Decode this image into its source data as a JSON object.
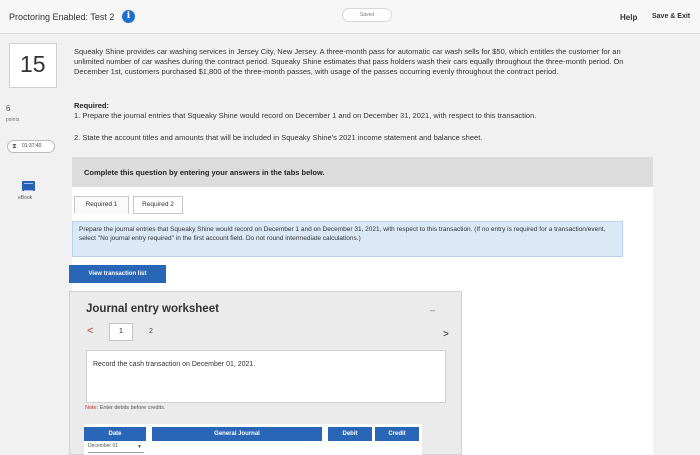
{
  "header": {
    "title": "Proctoring Enabled: Test 2",
    "saved_label": "Saved",
    "help_label": "Help",
    "save_exit_label": "Save & Exit"
  },
  "sidebar": {
    "question_number": "15",
    "points_value": "6",
    "points_label": "points",
    "timer": "01:37:40",
    "ebook_label": "eBook"
  },
  "question": {
    "text": "Squeaky Shine provides car washing services in Jersey City, New Jersey. A three-month pass for automatic car wash sells for $50, which entitles the customer for an unlimited number of car washes during the contract period. Squeaky Shine estimates that pass holders wash their cars equally throughout the three-month period. On December 1st, customers purchased $1,800 of the three-month passes, with usage of the passes occurring evenly throughout the contract period.",
    "required_title": "Required:",
    "required_1": "1. Prepare the journal entries that Squeaky Shine would record on December 1 and on December 31, 2021, with respect to this transaction.",
    "required_2": "2. State the account titles and amounts that will be included in Squeaky Shine's 2021 income statement and balance sheet."
  },
  "instruction": "Complete this question by entering your answers in the tabs below.",
  "tabs": [
    {
      "label": "Required 1"
    },
    {
      "label": "Required 2"
    }
  ],
  "prompt": "Prepare the journal entries that Squeaky Shine would record on December 1 and on December 31, 2021, with respect to this transaction. (If no entry is required for a transaction/event, select \"No journal entry required\" in the first account field. Do not round intermediate calculations.)",
  "view_transaction_label": "View transaction list",
  "worksheet": {
    "title": "Journal entry worksheet",
    "pages": [
      "1",
      "2"
    ],
    "record_text": "Record the cash transaction on December 01, 2021.",
    "note_label": "Note:",
    "note_text": "Enter debits before credits.",
    "columns": [
      "Date",
      "General Journal",
      "Debit",
      "Credit"
    ],
    "date_value": "December 01"
  },
  "colors": {
    "accent": "#2a66b8",
    "prompt_bg": "#dbe9f7",
    "nav_arrow": "#c03a2b"
  }
}
